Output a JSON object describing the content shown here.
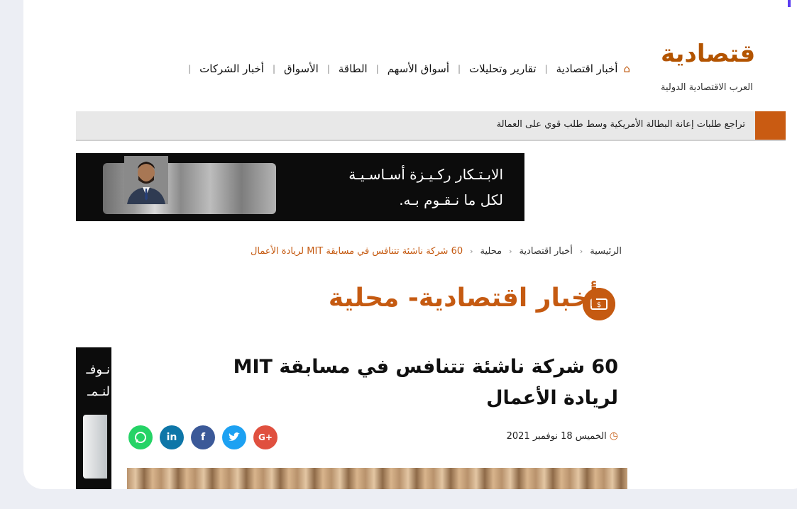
{
  "logo": {
    "mark": "قتصادية",
    "subtitle": "العرب الاقتصادية الدولية"
  },
  "nav": {
    "home_icon": "home-icon",
    "items": [
      "أخبار اقتصادية",
      "تقارير وتحليلات",
      "أسواق الأسهم",
      "الطاقة",
      "الأسواق",
      "أخبار الشركات"
    ],
    "separator": "|"
  },
  "ticker": {
    "text": "تراجع طلبات إعانة البطالة الأمريكية وسط طلب قوي على العمالة"
  },
  "banner": {
    "line1": "الابـتـكار ركـيـزة أسـاسـيـة",
    "line2": "لكل ما نـقـوم بـه."
  },
  "breadcrumb": {
    "items": [
      "الرئيسية",
      "أخبار اقتصادية",
      "محلية"
    ],
    "current": "60 شركة ناشئة تتنافس في مسابقة MIT لريادة الأعمال",
    "chevron": "‹"
  },
  "section": {
    "title": "أخبار اقتصادية- محلية",
    "icon": "money-icon"
  },
  "article": {
    "title": "60 شركة ناشئة تتنافس في مسابقة MIT لريادة الأعمال",
    "date": "الخميس 18 نوفمبر 2021",
    "clock_icon": "clock-icon"
  },
  "share": [
    {
      "name": "google-plus",
      "label": "G+",
      "color": "#e0503f"
    },
    {
      "name": "twitter",
      "label": "t",
      "color": "#1da1f2"
    },
    {
      "name": "facebook",
      "label": "f",
      "color": "#3b5998"
    },
    {
      "name": "linkedin",
      "label": "in",
      "color": "#0e76a8"
    },
    {
      "name": "whatsapp",
      "label": "w",
      "color": "#25d366"
    }
  ],
  "side_ad": {
    "line1": "نـوفـ",
    "line2": "لنـمـ"
  }
}
